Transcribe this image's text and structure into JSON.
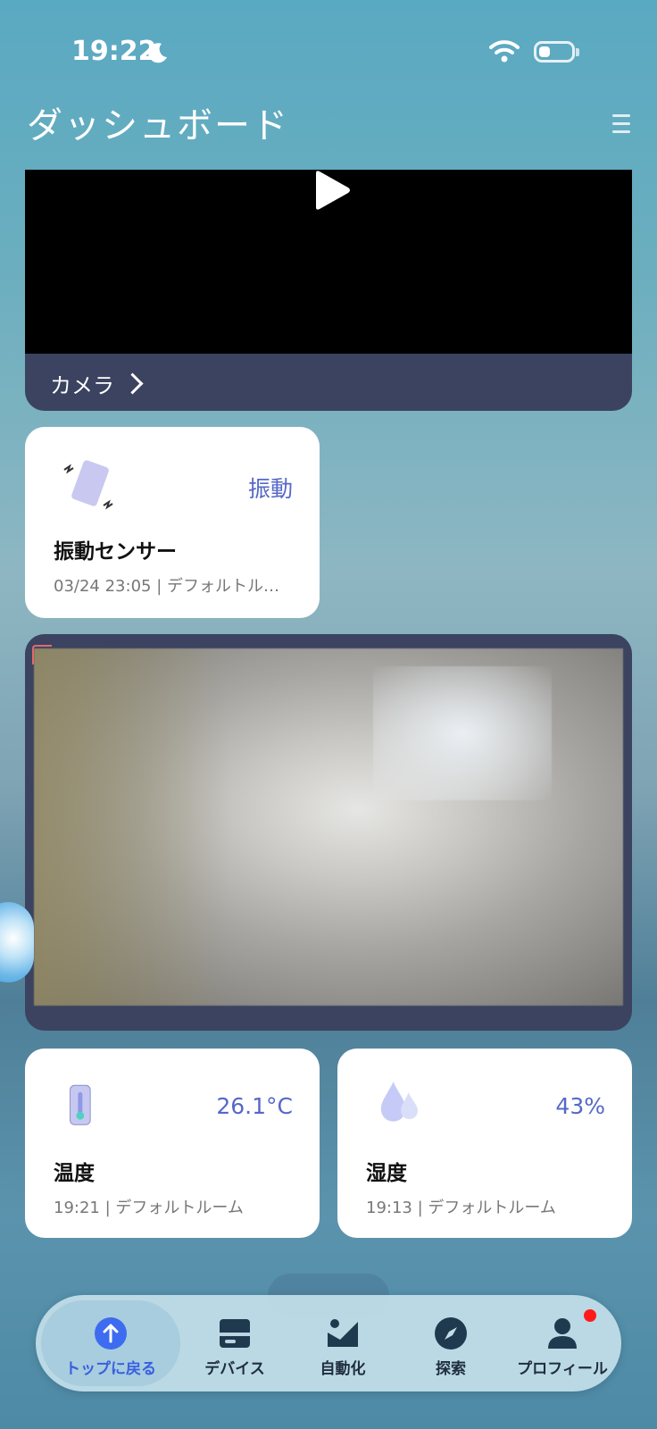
{
  "status_bar": {
    "time": "19:22"
  },
  "header": {
    "title": "ダッシュボード"
  },
  "camera_card": {
    "label": "カメラ"
  },
  "vibration_card": {
    "status": "振動",
    "name": "振動センサー",
    "meta": "03/24 23:05 | デフォルトルーム"
  },
  "temperature_card": {
    "value": "26.1°C",
    "name": "温度",
    "meta": "19:21 | デフォルトルーム"
  },
  "humidity_card": {
    "value": "43%",
    "name": "湿度",
    "meta": "19:13 | デフォルトルーム"
  },
  "tabbar": {
    "items": [
      {
        "label": "トップに戻る",
        "icon": "arrow-up-circle-icon",
        "active": true
      },
      {
        "label": "デバイス",
        "icon": "devices-icon"
      },
      {
        "label": "自動化",
        "icon": "automation-icon"
      },
      {
        "label": "探索",
        "icon": "compass-icon"
      },
      {
        "label": "プロフィール",
        "icon": "profile-icon",
        "badge": true
      }
    ]
  },
  "colors": {
    "accent": "#3a5fe0",
    "value_text": "#5668c8",
    "badge": "#ff1a1a"
  }
}
